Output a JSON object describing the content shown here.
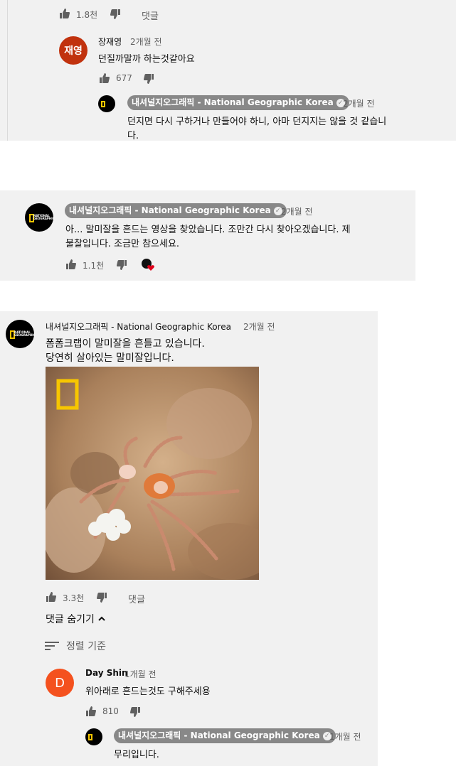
{
  "channel_name": "내셔널지오그래픽 - National Geographic Korea",
  "channel_logo_text": "NATIONAL GEOGRAPHIC",
  "top": {
    "like_count": "1.8천",
    "reply_label": "댓글",
    "reply1": {
      "avatar_text": "재영",
      "avatar_color": "#c1320e",
      "author": "장재영",
      "time": "2개월 전",
      "text": "던질까말까 하는것같아요",
      "like_count": "677"
    },
    "reply2": {
      "time": "2개월 전",
      "text_line1": "던지면 다시 구하거나 만들어야 하니, 아마 던지지는 않을 것 같습니",
      "text_line2": "다."
    }
  },
  "middle": {
    "time": "2개월 전",
    "text_line1": "아... 말미잘을 흔드는 영상을 찾았습니다. 조만간 다시 찾아오겠습니다. 제",
    "text_line2": "불찰입니다. 조금만 참으세요.",
    "like_count": "1.1천"
  },
  "bottom": {
    "time": "2개월 전",
    "text_line1": "폼폼크랩이 말미잘을 흔들고 있습니다.",
    "text_line2": "당연히 살아있는 말미잘입니다.",
    "like_count": "3.3천",
    "reply_label": "댓글",
    "hide_replies_label": "댓글 숨기기",
    "sort_label": "정렬 기준",
    "reply1": {
      "avatar_text": "D",
      "avatar_color": "#f4511e",
      "author": "Day Shin",
      "time": "1개월 전",
      "text": "위아래로 흔드는것도 구해주세용",
      "like_count": "810"
    },
    "reply2": {
      "time": "1개월 전",
      "text": "무리입니다."
    }
  },
  "colors": {
    "panel_bg": "#f1f1f1",
    "chip_bg": "#888888",
    "ng_yellow": "#f7c600",
    "heart": "#e0001b"
  }
}
